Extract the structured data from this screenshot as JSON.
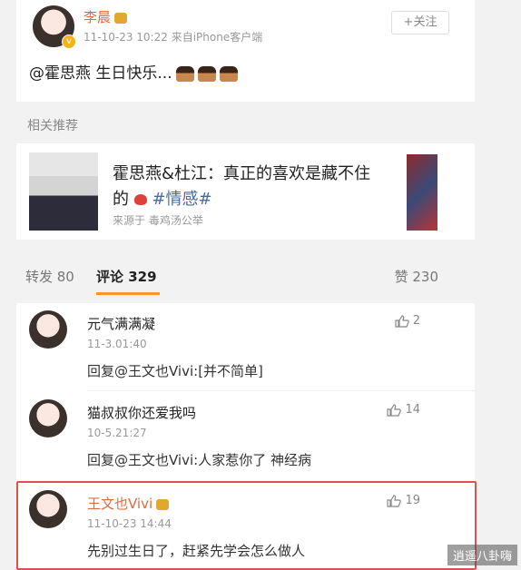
{
  "post": {
    "author": "李晨",
    "time": "11-10-23 10:22",
    "source": "来自iPhone客户端",
    "follow_label": "+关注",
    "text": "@霍思燕 生日快乐..."
  },
  "related": {
    "section_label": "相关推荐",
    "title_part1": "霍思燕&杜江：真正的喜欢是藏不住的",
    "hashtag": "#情感#",
    "source": "来源于  毒鸡汤公举"
  },
  "tabs": {
    "repost": "转发 80",
    "comment": "评论 329",
    "like": "赞 230"
  },
  "comments": [
    {
      "name": "元气满满凝",
      "time": "11-3.01:40",
      "text": "回复@王文也Vivi:[并不简单]",
      "likes": "2"
    },
    {
      "name": "猫叔叔你还爱我吗",
      "time": "10-5.21:27",
      "text": "回复@王文也Vivi:人家惹你了 神经病",
      "likes": "14"
    },
    {
      "name": "王文也Vivi",
      "time": "11-10-23 14:44",
      "text": "先别过生日了，赶紧先学会怎么做人",
      "likes": "19"
    }
  ],
  "watermark": "逍遥八卦嗨",
  "colors": {
    "highlight_border": "#d9534f",
    "tab_underline": "#f59a2a",
    "author_name": "#e06a3f"
  }
}
